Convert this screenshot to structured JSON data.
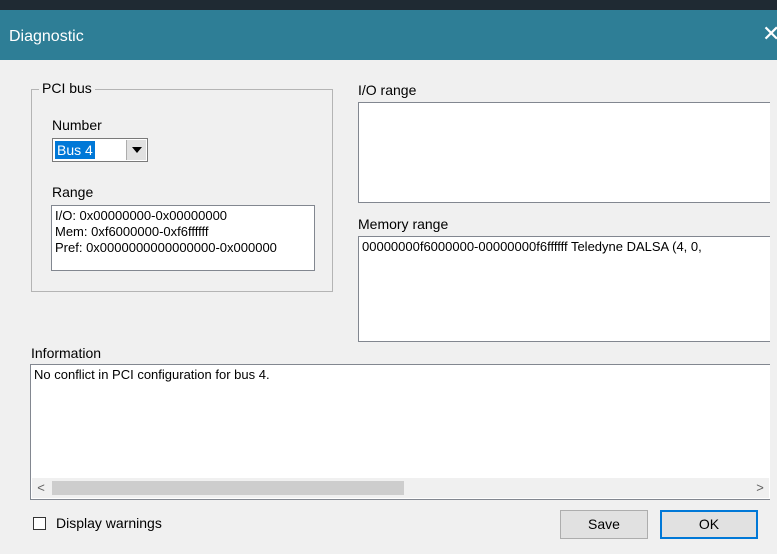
{
  "window": {
    "title": "Diagnostic",
    "close_glyph": "✕"
  },
  "pci_bus": {
    "legend": "PCI bus",
    "number_label": "Number",
    "bus_selected": "Bus 4",
    "range_label": "Range",
    "range_lines": [
      "I/O: 0x00000000-0x00000000",
      "Mem: 0xf6000000-0xf6ffffff",
      "Pref: 0x0000000000000000-0x000000"
    ]
  },
  "io_range": {
    "label": "I/O range",
    "lines": []
  },
  "memory_range": {
    "label": "Memory range",
    "lines": [
      "00000000f6000000-00000000f6ffffff Teledyne DALSA (4, 0,"
    ]
  },
  "information": {
    "label": "Information",
    "text": "No conflict in PCI configuration for bus 4.",
    "scroll_left": "<",
    "scroll_right": ">"
  },
  "footer": {
    "display_warnings_label": "Display warnings",
    "display_warnings_checked": false,
    "save_label": "Save",
    "ok_label": "OK"
  },
  "colors": {
    "titlebar": "#2e7e96",
    "selection": "#0078d7"
  },
  "icons": {
    "close": "close-icon",
    "dropdown": "chevron-down-icon"
  }
}
